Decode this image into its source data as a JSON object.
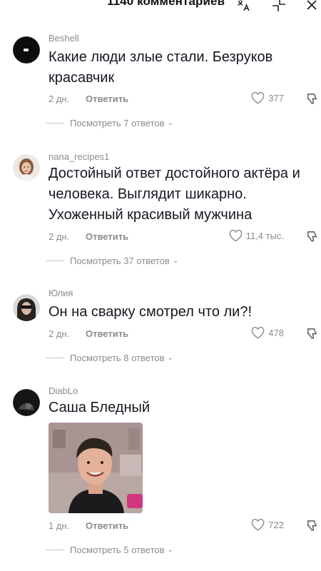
{
  "header": {
    "title": "1140 комментариев"
  },
  "comments": [
    {
      "username": "Beshell",
      "text": "Какие люди злые стали. Безруков красавчик",
      "time": "2 дн.",
      "reply_label": "Ответить",
      "likes": "377",
      "view_replies": "Посмотреть 7 ответов"
    },
    {
      "username": "nana_recipes1",
      "text": "Достойный ответ достойного актёра и человека. Выглядит шикарно. Ухоженный красивый мужчина",
      "time": "2 дн.",
      "reply_label": "Ответить",
      "likes": "11,4 тыс.",
      "view_replies": "Посмотреть 37 ответов"
    },
    {
      "username": "Юлия",
      "text": "Он на сварку смотрел что ли?!",
      "time": "2 дн.",
      "reply_label": "Ответить",
      "likes": "478",
      "view_replies": "Посмотреть 8 ответов"
    },
    {
      "username": "DiabLo",
      "text": "Саша Бледный",
      "time": "1 дн.",
      "reply_label": "Ответить",
      "likes": "722",
      "view_replies": "Посмотреть 5 ответов"
    }
  ],
  "icons": {
    "translate": "translate-icon",
    "collapse": "collapse-icon",
    "close": "close-icon",
    "like": "heart-icon",
    "dislike": "dislike-icon"
  },
  "colors": {
    "text": "#161823",
    "muted": "#8a8b91",
    "divider": "#c8c8cc"
  }
}
